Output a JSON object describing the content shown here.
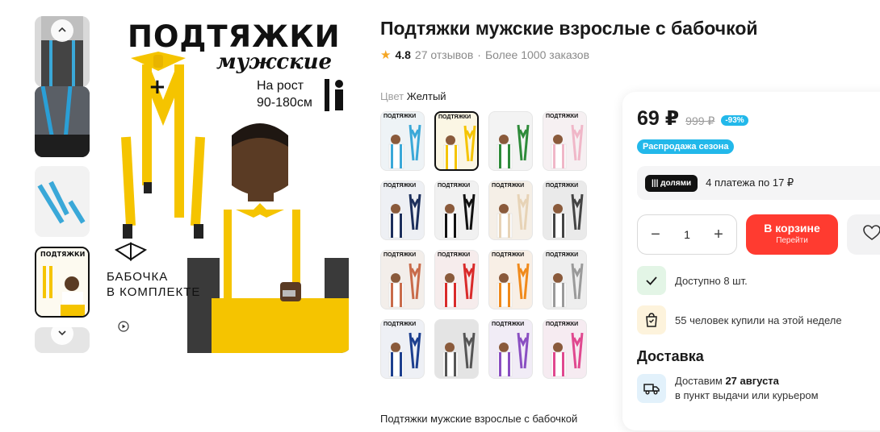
{
  "gallery": {
    "main_title": "ПОДТЯЖКИ",
    "main_subtitle": "мужские",
    "height_label_1": "На рост",
    "height_label_2": "90-180см",
    "bow_label_1": "БАБОЧКА",
    "bow_label_2": "В КОМПЛЕКТЕ",
    "thumb_up_icon": "chevron-up-icon",
    "thumb_down_icon": "chevron-down-icon",
    "play_icon": "play-icon"
  },
  "product": {
    "title": "Подтяжки мужские взрослые с бабочкой",
    "rating": "4.8",
    "reviews": "27 отзывов",
    "separator": "·",
    "orders": "Более 1000 заказов",
    "color_label": "Цвет",
    "color_value": "Желтый",
    "description": "Подтяжки мужские взрослые с бабочкой"
  },
  "swatches": [
    {
      "label": "ПОДТЯЖКИ",
      "color": "#3aa8d8",
      "bg": "#eef3f6",
      "active": false
    },
    {
      "label": "ПОДТЯЖКИ",
      "color": "#f5c400",
      "bg": "#fbf6e4",
      "active": true
    },
    {
      "label": "",
      "color": "#2e8b3a",
      "bg": "#f3f3f3",
      "active": false
    },
    {
      "label": "ПОДТЯЖКИ",
      "color": "#f0b7c8",
      "bg": "#f6f0f2",
      "active": false
    },
    {
      "label": "ПОДТЯЖКИ",
      "color": "#1c2f5c",
      "bg": "#eef0f4",
      "active": false
    },
    {
      "label": "ПОДТЯЖКИ",
      "color": "#111111",
      "bg": "#f1f1f1",
      "active": false
    },
    {
      "label": "ПОДТЯЖКИ",
      "color": "#e7d3b6",
      "bg": "#f5efe7",
      "active": false
    },
    {
      "label": "ПОДТЯЖКИ",
      "color": "#444444",
      "bg": "#eaeaea",
      "active": false
    },
    {
      "label": "ПОДТЯЖКИ",
      "color": "#c96b4a",
      "bg": "#f3eeea",
      "active": false
    },
    {
      "label": "ПОДТЯЖКИ",
      "color": "#d92b2b",
      "bg": "#f6ecec",
      "active": false
    },
    {
      "label": "ПОДТЯЖКИ",
      "color": "#f08a1c",
      "bg": "#f8efe6",
      "active": false
    },
    {
      "label": "ПОДТЯЖКИ",
      "color": "#9a9a9a",
      "bg": "#eeeeee",
      "active": false
    },
    {
      "label": "ПОДТЯЖКИ",
      "color": "#1d3f8f",
      "bg": "#eef0f5",
      "active": false
    },
    {
      "label": "",
      "color": "#555555",
      "bg": "#e4e4e4",
      "active": false
    },
    {
      "label": "ПОДТЯЖКИ",
      "color": "#8a4fc2",
      "bg": "#f1ecf6",
      "active": false
    },
    {
      "label": "ПОДТЯЖКИ",
      "color": "#e0488f",
      "bg": "#f6ebf1",
      "active": false
    }
  ],
  "buy": {
    "price": "69 ₽",
    "old_price": "999 ₽",
    "discount": "-93%",
    "sale_badge": "Распродажа сезона",
    "dolyami_label": "||| долями",
    "installments_text": "4 платежа по 17 ₽",
    "close_icon": "close-icon",
    "quantity": "1",
    "minus": "−",
    "plus": "+",
    "cart_label": "В корзине",
    "cart_sub": "Перейти",
    "heart_icon": "heart-icon",
    "stock_text": "Доступно 8 шт.",
    "weekly_text": "55 человек купили на этой неделе",
    "delivery_title": "Доставка",
    "delivery_prefix": "Доставим",
    "delivery_date": "27 августа",
    "delivery_sub": "в пункт выдачи или курьером"
  },
  "colors": {
    "accent_red": "#ff3b30",
    "accent_blue": "#22b8ea",
    "star": "#f5a623",
    "suspender_yellow": "#f5c400"
  }
}
